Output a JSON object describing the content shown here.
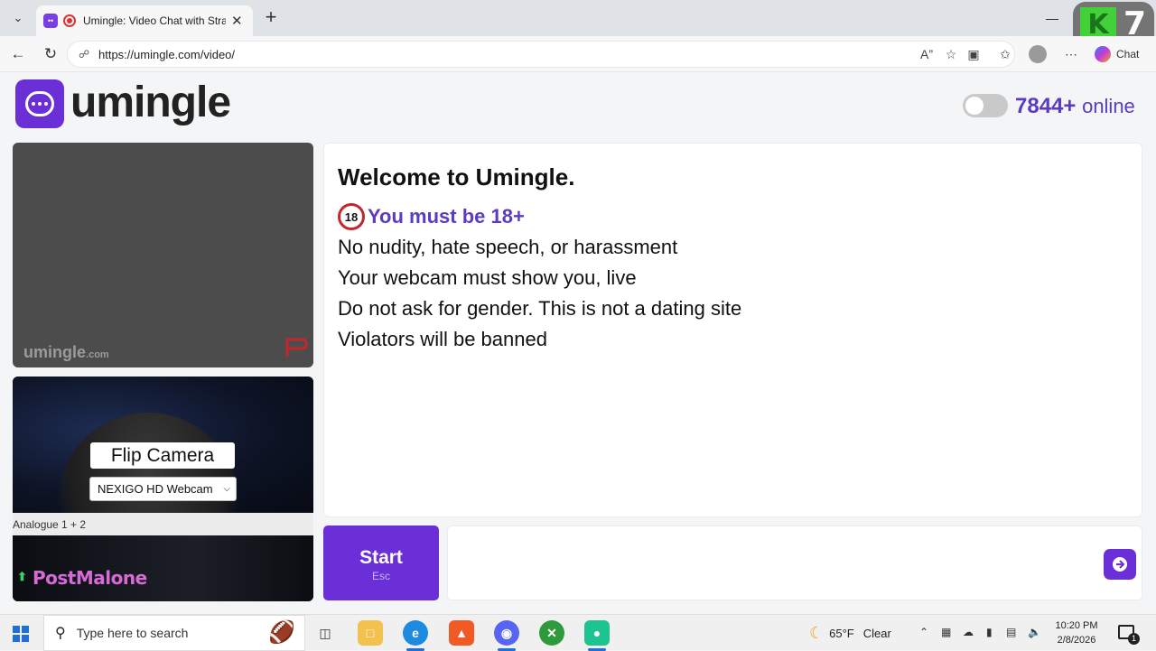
{
  "browser": {
    "tab_title": "Umingle: Video Chat with Stra",
    "url": "https://umingle.com/video/",
    "copilot_label": "Chat",
    "overlay_badge": "7",
    "overlay_letter": "K"
  },
  "header": {
    "logo_text": "umingle",
    "online_count": "7844+",
    "online_label": "online"
  },
  "video_top": {
    "watermark": "umingle",
    "watermark_suffix": ".com"
  },
  "video_bottom": {
    "flip_camera_label": "Flip Camera",
    "camera_select_value": "NEXIGO HD Webcam",
    "audio_label": "Analogue 1 + 2",
    "overlay_text": "PostMalone"
  },
  "chat": {
    "welcome": "Welcome to Umingle.",
    "age_badge": "18",
    "age_notice": "You must be 18+",
    "rules": [
      "No nudity, hate speech, or harassment",
      "Your webcam must show you, live",
      "Do not ask for gender. This is not a dating site",
      "Violators will be banned"
    ]
  },
  "controls": {
    "start_label": "Start",
    "start_shortcut": "Esc",
    "message_placeholder": ""
  },
  "taskbar": {
    "search_placeholder": "Type here to search",
    "temperature": "65°F",
    "weather_text": "Clear",
    "time": "10:20 PM",
    "date": "2/8/2026",
    "notification_count": "1"
  },
  "colors": {
    "brand_purple": "#6a2fd6",
    "online_text": "#5a3bc4",
    "age_ring": "#c2272d"
  }
}
